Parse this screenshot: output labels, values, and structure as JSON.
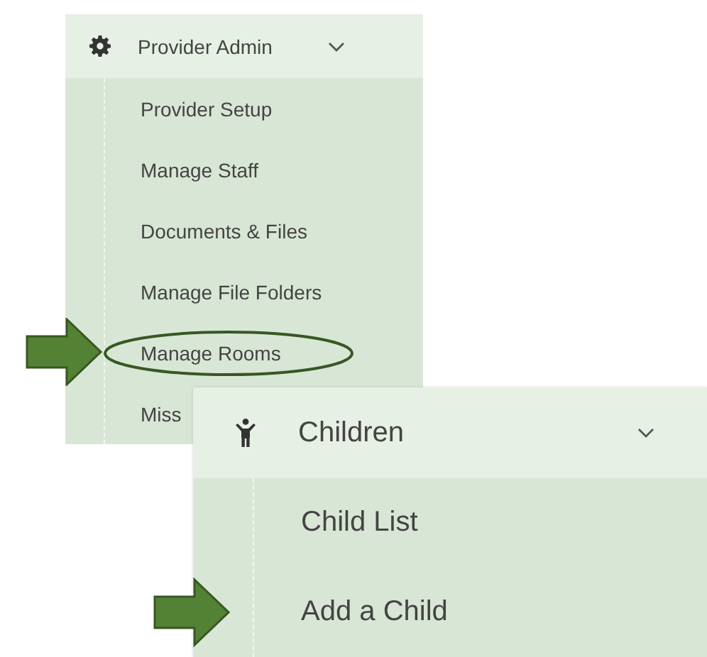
{
  "panels": [
    {
      "title": "Provider Admin",
      "expanded": true,
      "items": [
        {
          "label": "Provider Setup",
          "circled": false,
          "arrow": false
        },
        {
          "label": "Manage Staff",
          "circled": false,
          "arrow": false
        },
        {
          "label": "Documents & Files",
          "circled": false,
          "arrow": false
        },
        {
          "label": "Manage File Folders",
          "circled": false,
          "arrow": false
        },
        {
          "label": "Manage Rooms",
          "circled": true,
          "arrow": true
        },
        {
          "label": "Miss",
          "circled": false,
          "arrow": false
        }
      ]
    },
    {
      "title": "Children",
      "expanded": true,
      "items": [
        {
          "label": "Child List",
          "circled": false,
          "arrow": false
        },
        {
          "label": "Add a Child",
          "circled": false,
          "arrow": true
        }
      ]
    }
  ]
}
